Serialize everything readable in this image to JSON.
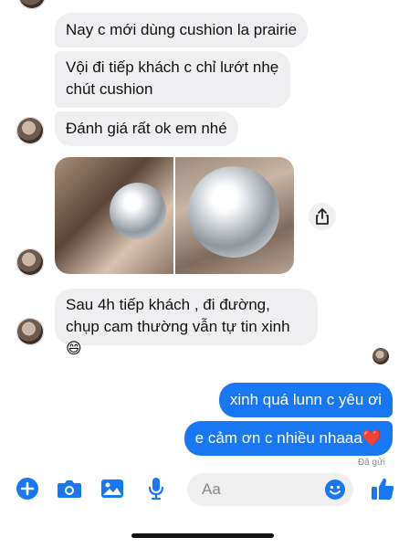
{
  "messages_incoming": [
    {
      "text": "Nay c mới dùng cushion la prairie"
    },
    {
      "text": "Vội đi tiếp khách c chỉ lướt nhẹ chút cushion"
    },
    {
      "text": "Đánh giá rất ok em nhé"
    },
    {
      "text": "Sau 4h tiếp khách , đi đường, chụp cam thường vẫn tự tin xinh 😄"
    }
  ],
  "messages_outgoing": [
    {
      "text": "xinh quá lunn c yêu ơi"
    },
    {
      "text": "e cảm ơn c nhiều nhaaa❤️"
    }
  ],
  "status": {
    "text": "Đã gửi"
  },
  "composer": {
    "placeholder": "Aa"
  },
  "icons": {
    "add": "plus-circle-icon",
    "camera": "camera-icon",
    "gallery": "image-icon",
    "mic": "microphone-icon",
    "emoji": "emoji-icon",
    "like": "thumbs-up-icon",
    "share": "share-icon"
  },
  "colors": {
    "accent": "#1877f2",
    "incoming_bg": "#efeff1",
    "input_bg": "#f0f0f0"
  }
}
